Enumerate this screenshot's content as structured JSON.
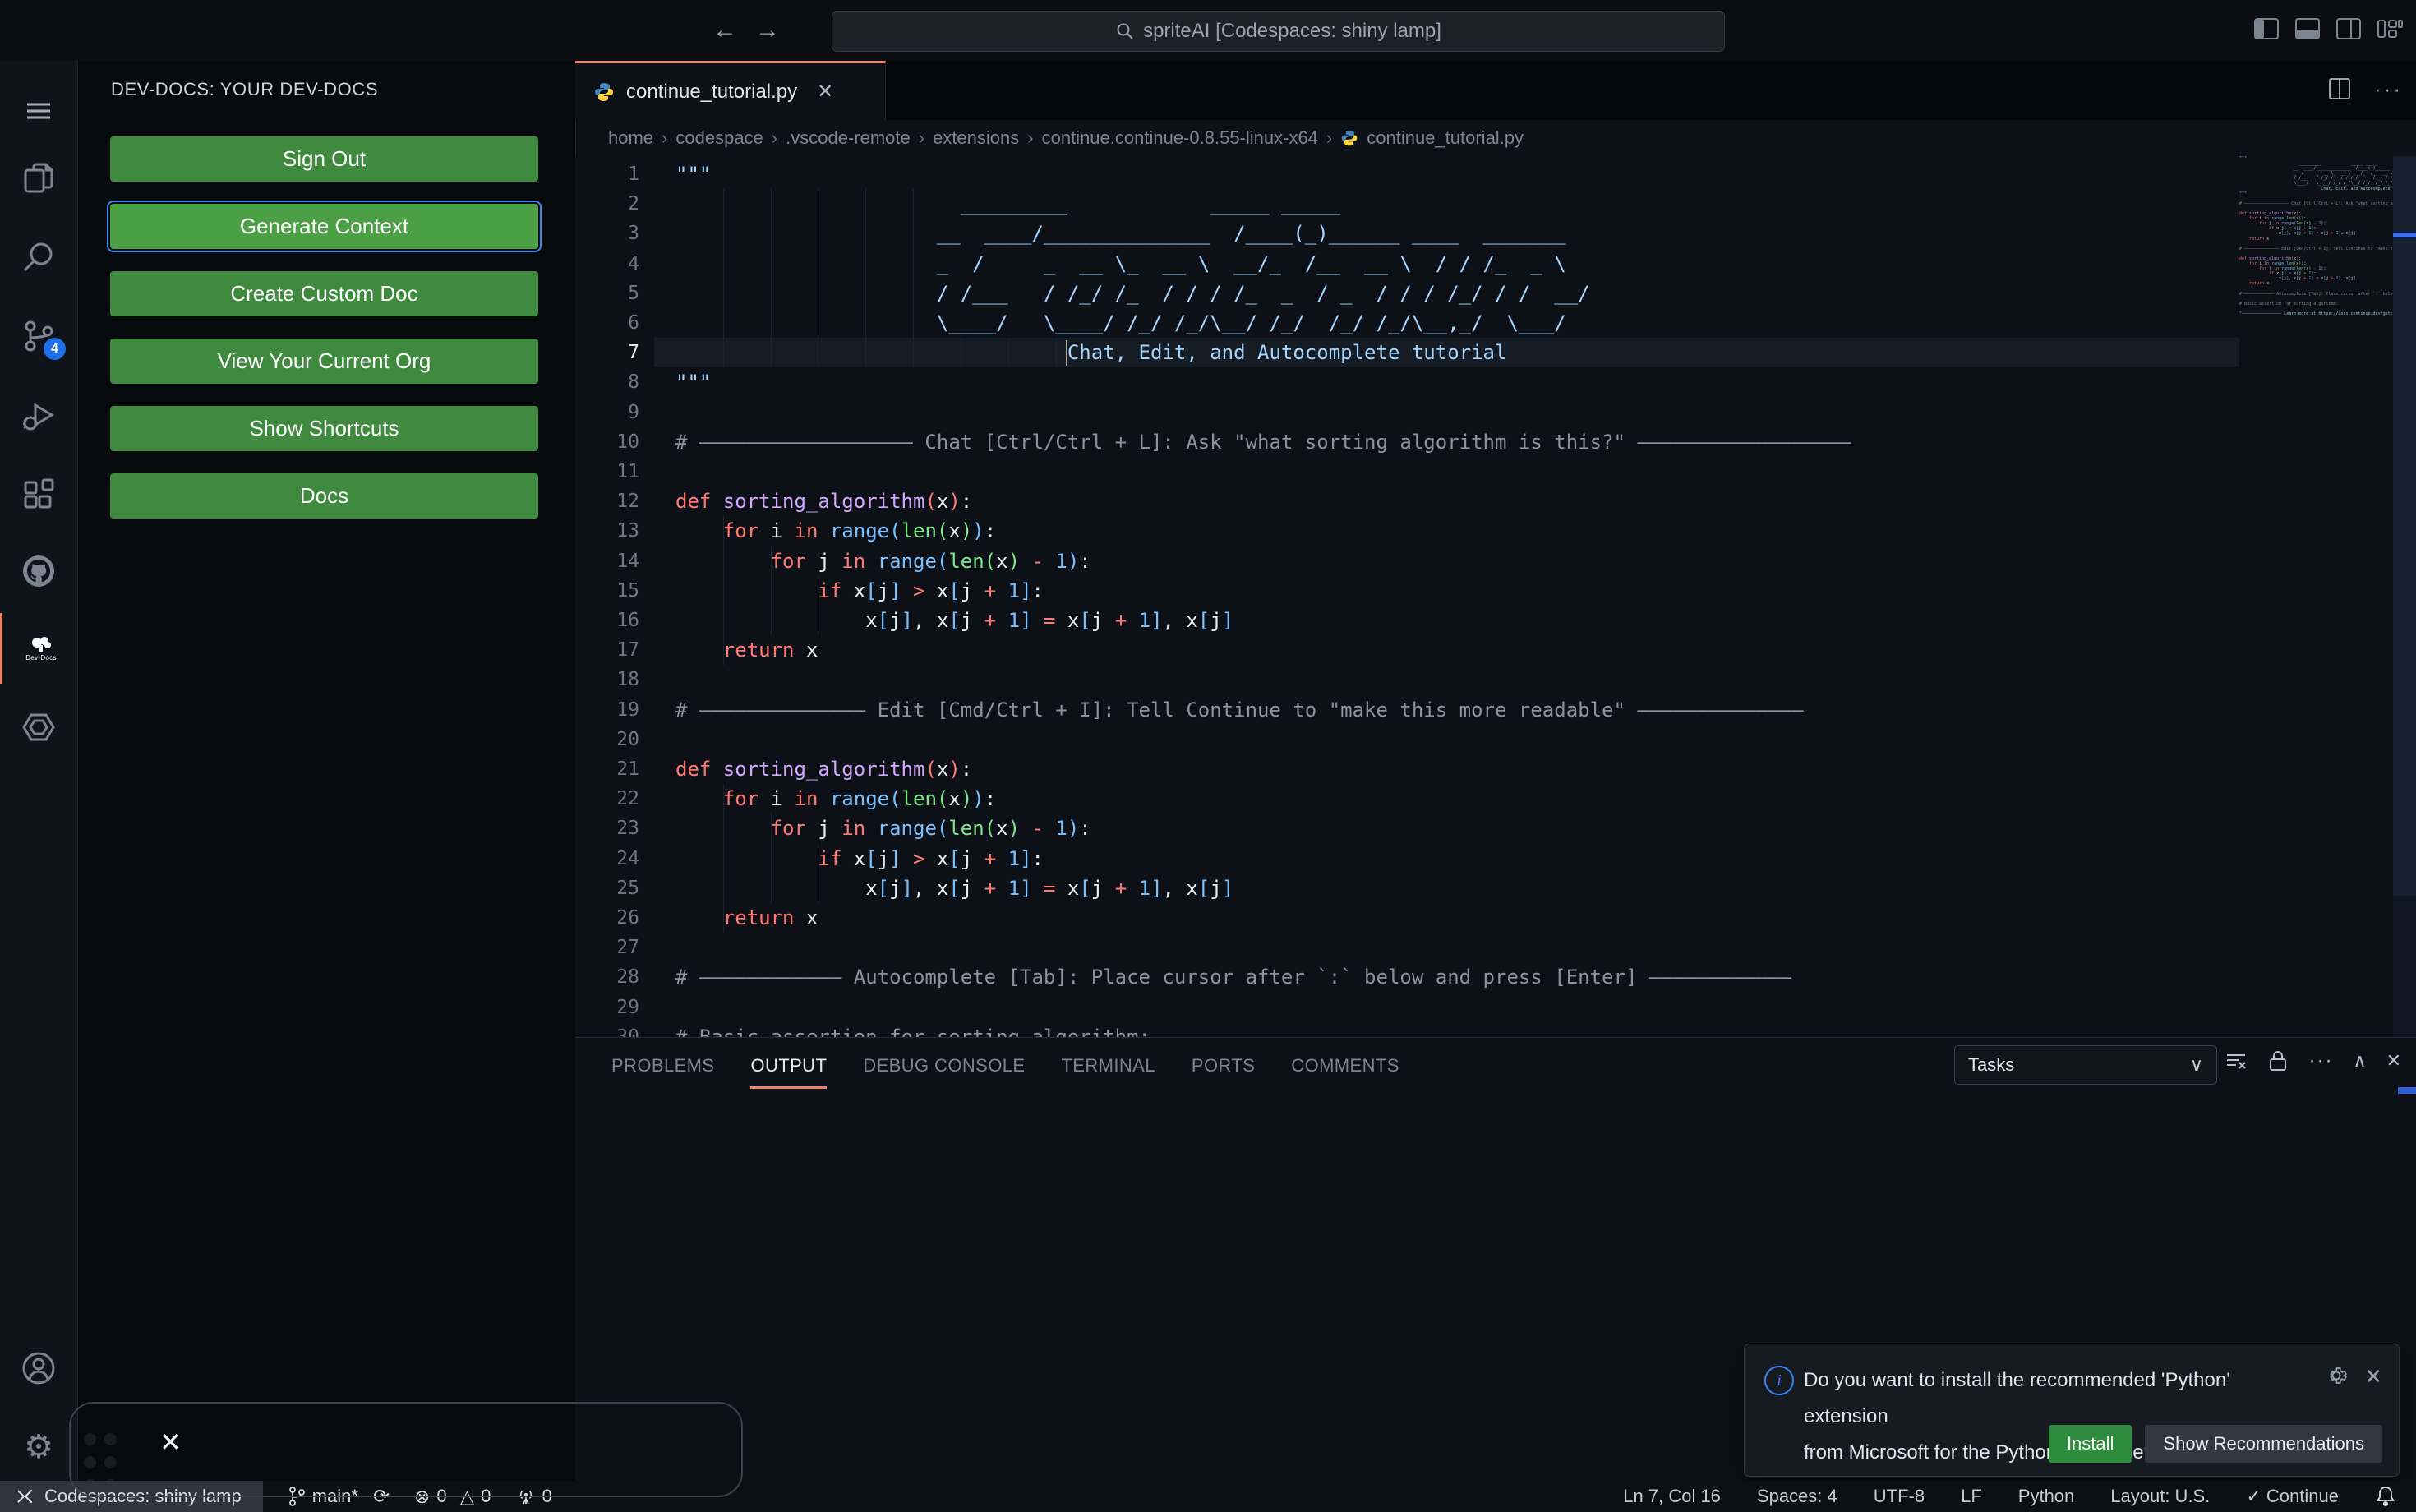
{
  "colors": {
    "accent_salmon": "#ee8269",
    "button_green": "#3f8a3f",
    "button_green_focused": "#4ba046",
    "focus_ring": "#3c82f7",
    "install_green": "#2e8a3d",
    "scm_badge_blue": "#1f6feb",
    "string": "#a5d6ff",
    "comment": "#8b949e",
    "keyword": "#ff7b72",
    "function": "#d2a8ff",
    "builtin_blue": "#79c0ff",
    "builtin_green": "#7ee787",
    "editor_bg": "#0d1117"
  },
  "title_bar": {
    "search_label": "spriteAI [Codespaces: shiny lamp]",
    "back": "←",
    "forward": "→"
  },
  "activity_bar": {
    "scm_badge": "4",
    "devdocs_word": "Dev-Docs",
    "items": [
      "menu",
      "explorer",
      "search",
      "source-control",
      "run-debug",
      "extensions",
      "github",
      "dev-docs",
      "continue"
    ],
    "bottom_items": [
      "account",
      "settings"
    ]
  },
  "sidebar": {
    "header": "DEV-DOCS: YOUR DEV-DOCS",
    "buttons": [
      {
        "label": "Sign Out",
        "focused": false
      },
      {
        "label": "Generate Context",
        "focused": true
      },
      {
        "label": "Create Custom Doc",
        "focused": false
      },
      {
        "label": "View Your Current Org",
        "focused": false
      },
      {
        "label": "Show Shortcuts",
        "focused": false
      },
      {
        "label": "Docs",
        "focused": false
      }
    ]
  },
  "editor": {
    "tab": {
      "label": "continue_tutorial.py",
      "close": "✕"
    },
    "breadcrumbs": [
      "home",
      "codespace",
      ".vscode-remote",
      "extensions",
      "continue.continue-0.8.55-linux-x64",
      "continue_tutorial.py"
    ],
    "cursor": {
      "line": 7,
      "col": 16
    },
    "lines": [
      {
        "n": 1,
        "g": 0,
        "seg": [
          [
            "s",
            "\"\"\""
          ]
        ]
      },
      {
        "n": 2,
        "g": 5,
        "seg": [
          [
            "s",
            "                        _________            _____ _____"
          ]
        ]
      },
      {
        "n": 3,
        "g": 5,
        "seg": [
          [
            "s",
            "                      __  ____/______________  /____(_)______ ____  _______"
          ]
        ]
      },
      {
        "n": 4,
        "g": 5,
        "seg": [
          [
            "s",
            "                      _  /     _  __ \\_  __ \\  __/_  /__  __ \\  / / /_  _ \\"
          ]
        ]
      },
      {
        "n": 5,
        "g": 5,
        "seg": [
          [
            "s",
            "                      / /___   / /_/ /_  / / / /_  _  / _  / / / /_/ / /  __/"
          ]
        ]
      },
      {
        "n": 6,
        "g": 5,
        "seg": [
          [
            "s",
            "                      \\____/   \\____/ /_/ /_/\\__/ /_/  /_/ /_/\\__,_/  \\___/"
          ]
        ]
      },
      {
        "n": 7,
        "g": 8,
        "seg": [
          [
            "s",
            "                                 Chat, Edit, and Autocomplete tutorial"
          ]
        ]
      },
      {
        "n": 8,
        "g": 0,
        "seg": [
          [
            "s",
            "\"\"\""
          ]
        ]
      },
      {
        "n": 9,
        "g": 0,
        "seg": []
      },
      {
        "n": 10,
        "g": 0,
        "seg": [
          [
            "c",
            "# —————————————————— Chat [Ctrl/Ctrl + L]: Ask \"what sorting algorithm is this?\" ——————————————————"
          ]
        ]
      },
      {
        "n": 11,
        "g": 0,
        "seg": []
      },
      {
        "n": 12,
        "g": 0,
        "seg": [
          [
            "k",
            "def "
          ],
          [
            "f",
            "sorting_algorithm"
          ],
          [
            "k",
            "("
          ],
          [
            "p",
            "x"
          ],
          [
            "k",
            ")"
          ],
          [
            "p",
            ":"
          ]
        ]
      },
      {
        "n": 13,
        "g": 1,
        "seg": [
          [
            "p",
            "    "
          ],
          [
            "k",
            "for "
          ],
          [
            "p",
            "i "
          ],
          [
            "k",
            "in "
          ],
          [
            "b",
            "range("
          ],
          [
            "g",
            "len("
          ],
          [
            "p",
            "x"
          ],
          [
            "g",
            ")"
          ],
          [
            "b",
            ")"
          ],
          [
            "p",
            ":"
          ]
        ]
      },
      {
        "n": 14,
        "g": 2,
        "seg": [
          [
            "p",
            "        "
          ],
          [
            "k",
            "for "
          ],
          [
            "p",
            "j "
          ],
          [
            "k",
            "in "
          ],
          [
            "b",
            "range("
          ],
          [
            "g",
            "len("
          ],
          [
            "p",
            "x"
          ],
          [
            "g",
            ")"
          ],
          [
            "p",
            " "
          ],
          [
            "k",
            "-"
          ],
          [
            "b",
            " 1"
          ],
          [
            "b",
            ")"
          ],
          [
            "p",
            ":"
          ]
        ]
      },
      {
        "n": 15,
        "g": 3,
        "seg": [
          [
            "p",
            "            "
          ],
          [
            "k",
            "if "
          ],
          [
            "p",
            "x"
          ],
          [
            "d",
            "["
          ],
          [
            "p",
            "j"
          ],
          [
            "d",
            "]"
          ],
          [
            "p",
            " "
          ],
          [
            "k",
            ">"
          ],
          [
            "p",
            " x"
          ],
          [
            "d",
            "["
          ],
          [
            "p",
            "j "
          ],
          [
            "k",
            "+"
          ],
          [
            "b",
            " 1"
          ],
          [
            "d",
            "]"
          ],
          [
            "p",
            ":"
          ]
        ]
      },
      {
        "n": 16,
        "g": 3,
        "seg": [
          [
            "p",
            "                "
          ],
          [
            "p",
            "x"
          ],
          [
            "d",
            "["
          ],
          [
            "p",
            "j"
          ],
          [
            "d",
            "]"
          ],
          [
            "p",
            ", x"
          ],
          [
            "d",
            "["
          ],
          [
            "p",
            "j "
          ],
          [
            "k",
            "+"
          ],
          [
            "b",
            " 1"
          ],
          [
            "d",
            "]"
          ],
          [
            "p",
            " "
          ],
          [
            "k",
            "="
          ],
          [
            "p",
            " x"
          ],
          [
            "d",
            "["
          ],
          [
            "p",
            "j "
          ],
          [
            "k",
            "+"
          ],
          [
            "b",
            " 1"
          ],
          [
            "d",
            "]"
          ],
          [
            "p",
            ", x"
          ],
          [
            "d",
            "["
          ],
          [
            "p",
            "j"
          ],
          [
            "d",
            "]"
          ]
        ]
      },
      {
        "n": 17,
        "g": 1,
        "seg": [
          [
            "p",
            "    "
          ],
          [
            "k",
            "return"
          ],
          [
            "p",
            " x"
          ]
        ]
      },
      {
        "n": 18,
        "g": 0,
        "seg": []
      },
      {
        "n": 19,
        "g": 0,
        "seg": [
          [
            "c",
            "# —————————————— Edit [Cmd/Ctrl + I]: Tell Continue to \"make this more readable\" ——————————————"
          ]
        ]
      },
      {
        "n": 20,
        "g": 0,
        "seg": []
      },
      {
        "n": 21,
        "g": 0,
        "seg": [
          [
            "k",
            "def "
          ],
          [
            "f",
            "sorting_algorithm"
          ],
          [
            "k",
            "("
          ],
          [
            "p",
            "x"
          ],
          [
            "k",
            ")"
          ],
          [
            "p",
            ":"
          ]
        ]
      },
      {
        "n": 22,
        "g": 1,
        "seg": [
          [
            "p",
            "    "
          ],
          [
            "k",
            "for "
          ],
          [
            "p",
            "i "
          ],
          [
            "k",
            "in "
          ],
          [
            "b",
            "range("
          ],
          [
            "g",
            "len("
          ],
          [
            "p",
            "x"
          ],
          [
            "g",
            ")"
          ],
          [
            "b",
            ")"
          ],
          [
            "p",
            ":"
          ]
        ]
      },
      {
        "n": 23,
        "g": 2,
        "seg": [
          [
            "p",
            "        "
          ],
          [
            "k",
            "for "
          ],
          [
            "p",
            "j "
          ],
          [
            "k",
            "in "
          ],
          [
            "b",
            "range("
          ],
          [
            "g",
            "len("
          ],
          [
            "p",
            "x"
          ],
          [
            "g",
            ")"
          ],
          [
            "p",
            " "
          ],
          [
            "k",
            "-"
          ],
          [
            "b",
            " 1"
          ],
          [
            "b",
            ")"
          ],
          [
            "p",
            ":"
          ]
        ]
      },
      {
        "n": 24,
        "g": 3,
        "seg": [
          [
            "p",
            "            "
          ],
          [
            "k",
            "if "
          ],
          [
            "p",
            "x"
          ],
          [
            "d",
            "["
          ],
          [
            "p",
            "j"
          ],
          [
            "d",
            "]"
          ],
          [
            "p",
            " "
          ],
          [
            "k",
            ">"
          ],
          [
            "p",
            " x"
          ],
          [
            "d",
            "["
          ],
          [
            "p",
            "j "
          ],
          [
            "k",
            "+"
          ],
          [
            "b",
            " 1"
          ],
          [
            "d",
            "]"
          ],
          [
            "p",
            ":"
          ]
        ]
      },
      {
        "n": 25,
        "g": 3,
        "seg": [
          [
            "p",
            "                "
          ],
          [
            "p",
            "x"
          ],
          [
            "d",
            "["
          ],
          [
            "p",
            "j"
          ],
          [
            "d",
            "]"
          ],
          [
            "p",
            ", x"
          ],
          [
            "d",
            "["
          ],
          [
            "p",
            "j "
          ],
          [
            "k",
            "+"
          ],
          [
            "b",
            " 1"
          ],
          [
            "d",
            "]"
          ],
          [
            "p",
            " "
          ],
          [
            "k",
            "="
          ],
          [
            "p",
            " x"
          ],
          [
            "d",
            "["
          ],
          [
            "p",
            "j "
          ],
          [
            "k",
            "+"
          ],
          [
            "b",
            " 1"
          ],
          [
            "d",
            "]"
          ],
          [
            "p",
            ", x"
          ],
          [
            "d",
            "["
          ],
          [
            "p",
            "j"
          ],
          [
            "d",
            "]"
          ]
        ]
      },
      {
        "n": 26,
        "g": 1,
        "seg": [
          [
            "p",
            "    "
          ],
          [
            "k",
            "return"
          ],
          [
            "p",
            " x"
          ]
        ]
      },
      {
        "n": 27,
        "g": 0,
        "seg": []
      },
      {
        "n": 28,
        "g": 0,
        "seg": [
          [
            "c",
            "# ———————————— Autocomplete [Tab]: Place cursor after `:` below and press [Enter] ————————————"
          ]
        ]
      },
      {
        "n": 29,
        "g": 0,
        "seg": []
      },
      {
        "n": 30,
        "g": 0,
        "seg": [
          [
            "c",
            "# Basic assertion for sorting algorithm:"
          ]
        ]
      }
    ],
    "minimap_extra": [
      {
        "n": 31,
        "g": 0,
        "seg": []
      },
      {
        "n": 32,
        "g": 0,
        "seg": [
          [
            "s",
            "\"———————————————— Learn more at https://docs.continue.dev/getting-started/overview ————————————————\""
          ]
        ]
      }
    ]
  },
  "panel": {
    "tabs": [
      "PROBLEMS",
      "OUTPUT",
      "DEBUG CONSOLE",
      "TERMINAL",
      "PORTS",
      "COMMENTS"
    ],
    "active_tab": "OUTPUT",
    "tasks_label": "Tasks",
    "actions": [
      "clear-output",
      "lock",
      "more",
      "chevron-up",
      "close"
    ]
  },
  "notification": {
    "line1": "Do you want to install the recommended 'Python' extension",
    "line2": "from Microsoft for the Python language?",
    "info_glyph": "i",
    "install_label": "Install",
    "show_recs_label": "Show Recommendations",
    "close": "✕"
  },
  "overlay_box": {
    "close": "✕"
  },
  "status_bar": {
    "remote_label": "Codespaces: shiny lamp",
    "branch": "main*",
    "errors": "0",
    "warnings": "0",
    "ports": "0",
    "right_items": [
      "Ln 7, Col 16",
      "Spaces: 4",
      "UTF-8",
      "LF",
      "Python",
      "Layout: U.S."
    ],
    "continue_item": "Continue",
    "check": "✓"
  }
}
